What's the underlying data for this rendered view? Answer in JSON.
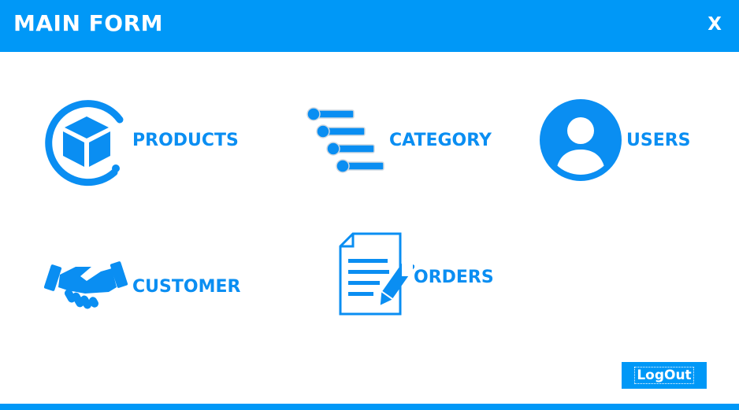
{
  "window": {
    "title": "MAIN FORM",
    "close_label": "X"
  },
  "menu": {
    "products": "PRODUCTS",
    "category": "CATEGORY",
    "users": "USERS",
    "customer": "CUSTOMER",
    "orders": "ORDERS"
  },
  "footer": {
    "logout_label": "LogOut"
  },
  "colors": {
    "accent": "#0098f7",
    "label": "#0a8ef2",
    "background": "#ffffff"
  },
  "icons": {
    "products": "box-icon",
    "category": "category-list-icon",
    "users": "user-avatar-icon",
    "customer": "handshake-icon",
    "orders": "order-document-icon"
  }
}
